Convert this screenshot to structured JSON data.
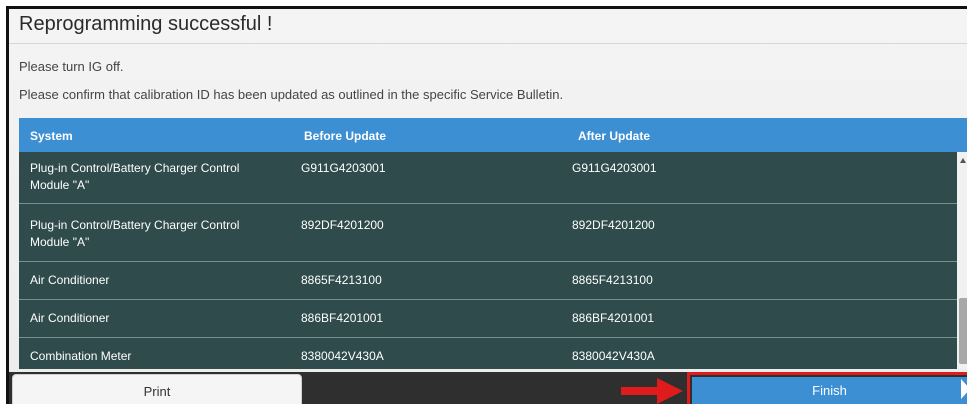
{
  "header": {
    "title": "Reprogramming successful !",
    "message_ig_off": "Please turn IG off.",
    "message_confirm": "Please confirm that calibration ID has been updated as outlined in the specific Service Bulletin."
  },
  "table": {
    "columns": [
      "System",
      "Before Update",
      "After Update"
    ],
    "rows": [
      {
        "system": "Plug-in Control/Battery Charger Control Module \"A\"",
        "before": "G911G4203001",
        "after": "G911G4203001"
      },
      {
        "system": "Plug-in Control/Battery Charger Control Module \"A\"",
        "before": "892DF4201200",
        "after": "892DF4201200"
      },
      {
        "system": "Air Conditioner",
        "before": "8865F4213100",
        "after": "8865F4213100"
      },
      {
        "system": "Air Conditioner",
        "before": "886BF4201001",
        "after": "886BF4201001"
      },
      {
        "system": "Combination Meter",
        "before": "8380042V430A",
        "after": "8380042V430A"
      }
    ]
  },
  "footer": {
    "print_label": "Print",
    "finish_label": "Finish"
  },
  "colors": {
    "header_blue": "#3d8fd4",
    "row_bg": "#2f4b4b",
    "highlight_red": "#e01b1b"
  }
}
